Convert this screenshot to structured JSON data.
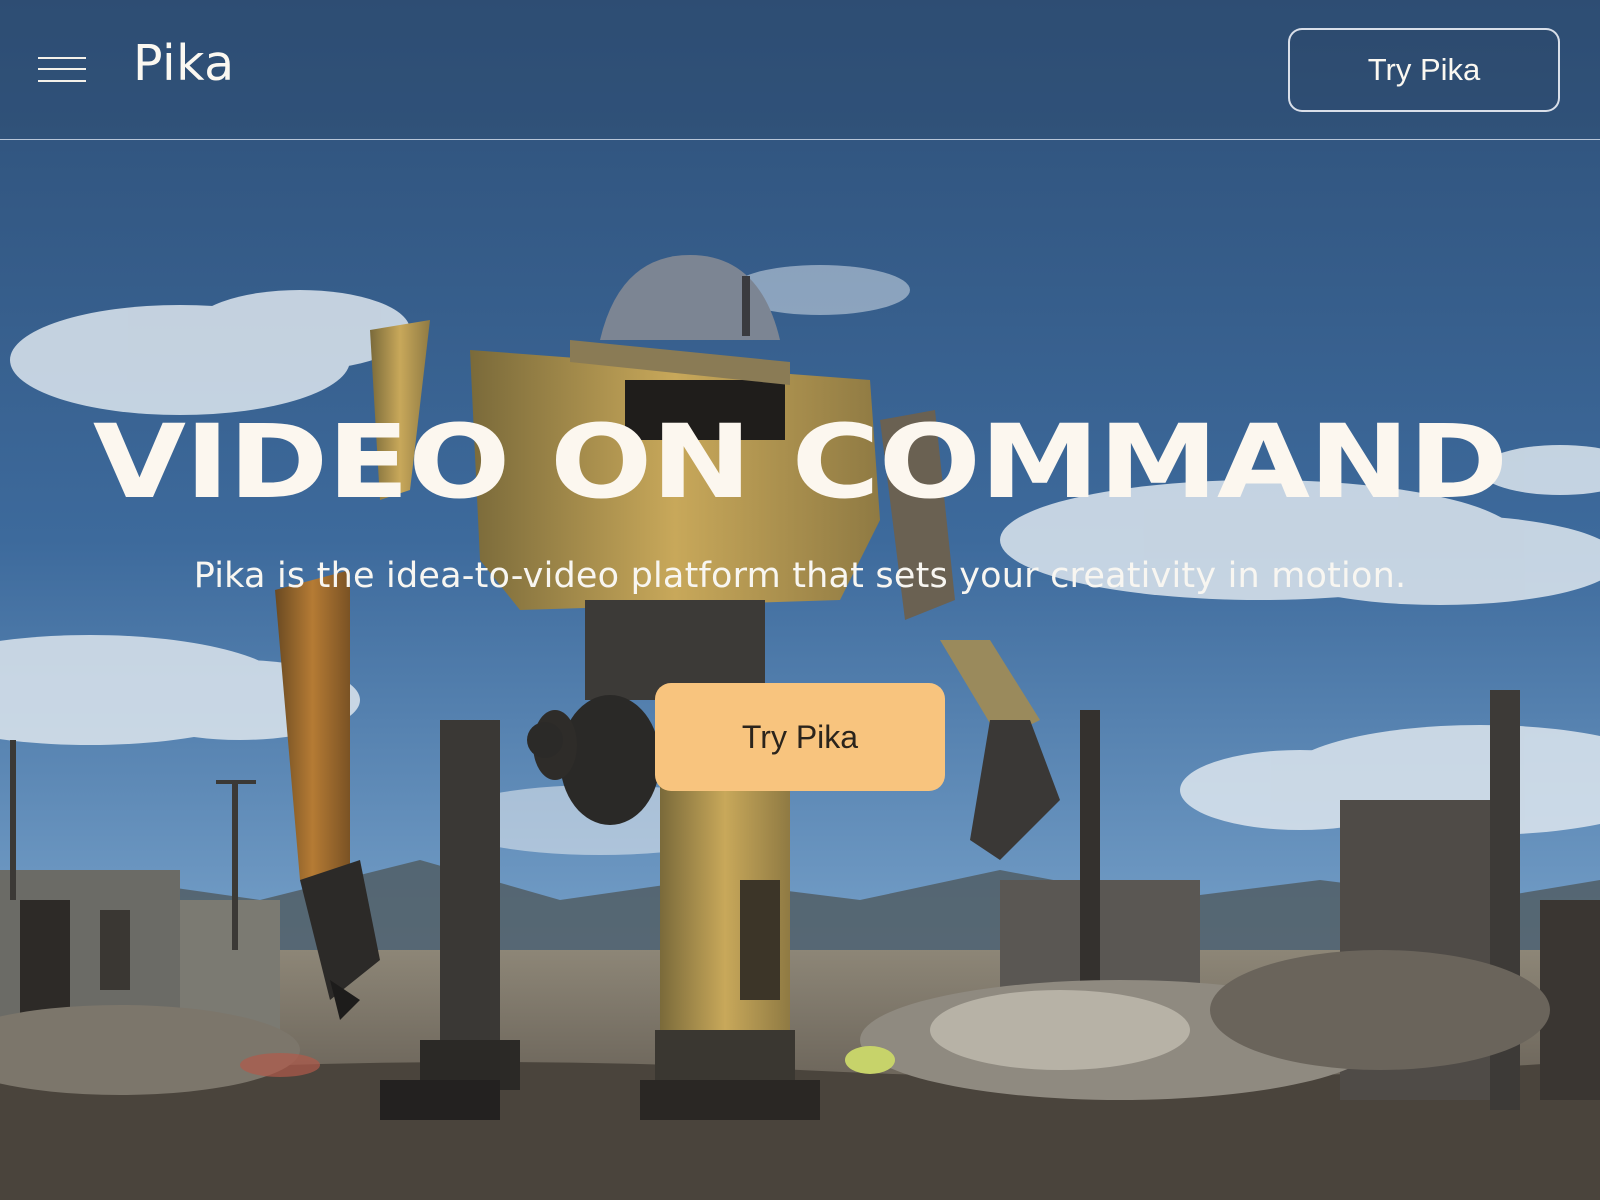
{
  "header": {
    "menu_icon": "hamburger-menu-icon",
    "logo_text": "Pika",
    "cta_label": "Try Pika"
  },
  "hero": {
    "title": "VIDEO ON COMMAND",
    "subtitle": "Pika is the idea-to-video platform that sets your creativity in motion.",
    "cta_label": "Try Pika",
    "background": "robot-in-wasteland-video"
  },
  "colors": {
    "accent": "#f8c47e",
    "text_light": "#fcf7ef",
    "sky_top": "#2f527c",
    "sky_bottom": "#6f9ac4"
  }
}
